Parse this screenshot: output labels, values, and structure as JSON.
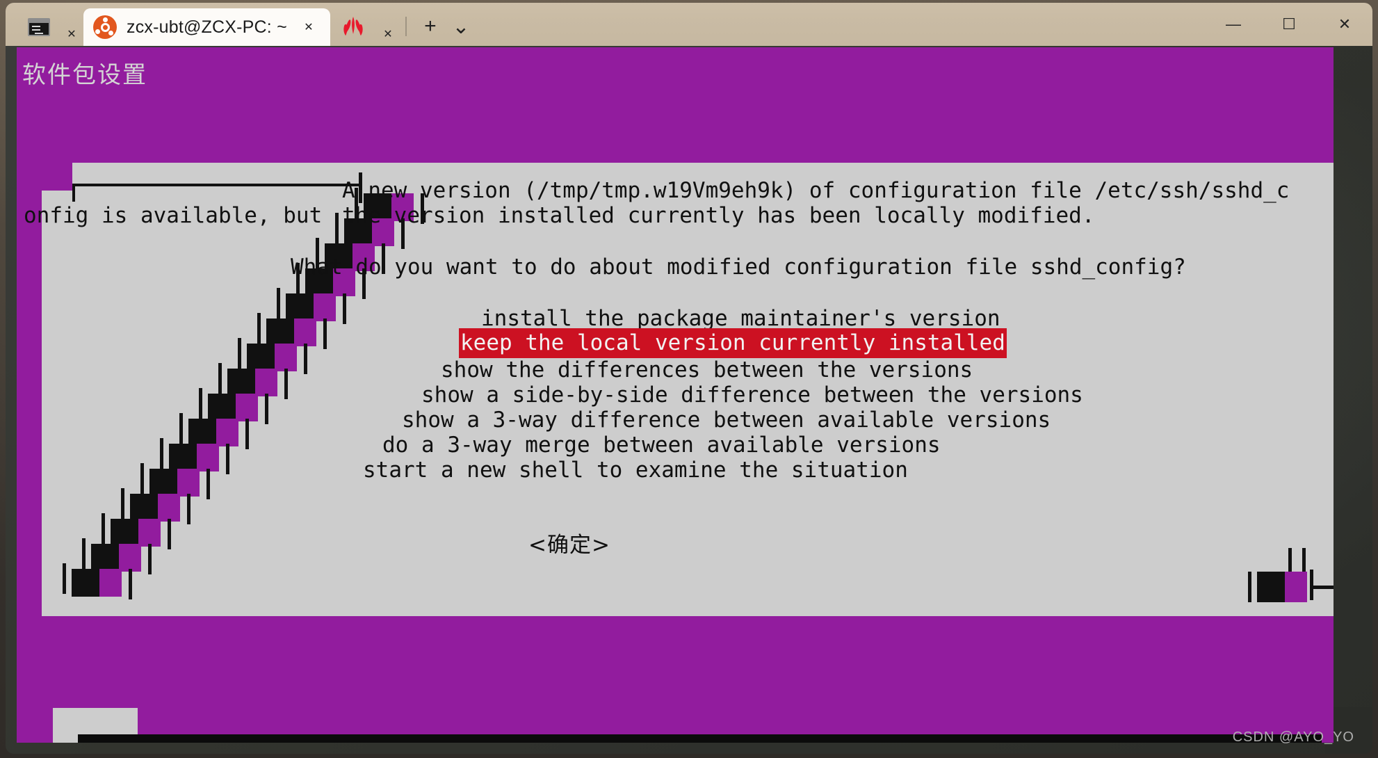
{
  "window": {
    "tabs": [
      {
        "label": "",
        "icon": "cmd-prompt-icon",
        "active": false,
        "close_label": "✕"
      },
      {
        "label": "zcx-ubt@ZCX-PC: ~",
        "icon": "ubuntu-icon",
        "active": true,
        "close_label": "✕"
      },
      {
        "label": "",
        "icon": "huawei-icon",
        "active": false,
        "close_label": "✕"
      }
    ],
    "new_tab_label": "+",
    "dropdown_label": "⌄",
    "controls": {
      "minimize": "—",
      "maximize": "☐",
      "close": "✕"
    }
  },
  "terminal": {
    "heading": "软件包设置",
    "colors": {
      "background_purple": "#921c9e",
      "dialog_grey": "#cdcdcd",
      "selection_red": "#cc1122",
      "text_black": "#101010",
      "heading_grey": "#d4d4d4"
    },
    "body_lines": [
      "A new version (/tmp/tmp.w19Vm9eh9k) of configuration file /etc/ssh/sshd_c",
      "onfig is available, but",
      "the version installed currently has been locally modified.",
      "What do you want to do about modified configuration file sshd_config?"
    ],
    "prompt_line1_a": "A new version (/tmp/tmp.w19Vm9eh9k) of configuration file /etc/ssh/sshd_c",
    "prompt_line1_b": "onfig is available, but",
    "prompt_line1_c": "the version installed currently has been locally modified.",
    "question": "What do you want to do about modified configuration file sshd_config?",
    "menu": [
      {
        "label": "install the package maintainer's version",
        "selected": false
      },
      {
        "label": "keep the local version currently installed",
        "selected": true
      },
      {
        "label": "show the differences between the versions",
        "selected": false
      },
      {
        "label": "show a side-by-side difference between the versions",
        "selected": false
      },
      {
        "label": "show a 3-way difference between available versions",
        "selected": false
      },
      {
        "label": "do a 3-way merge between available versions",
        "selected": false
      },
      {
        "label": "start a new shell to examine the situation",
        "selected": false
      }
    ],
    "ok_button": "<确定>"
  },
  "watermark": "CSDN @AYO_YO"
}
